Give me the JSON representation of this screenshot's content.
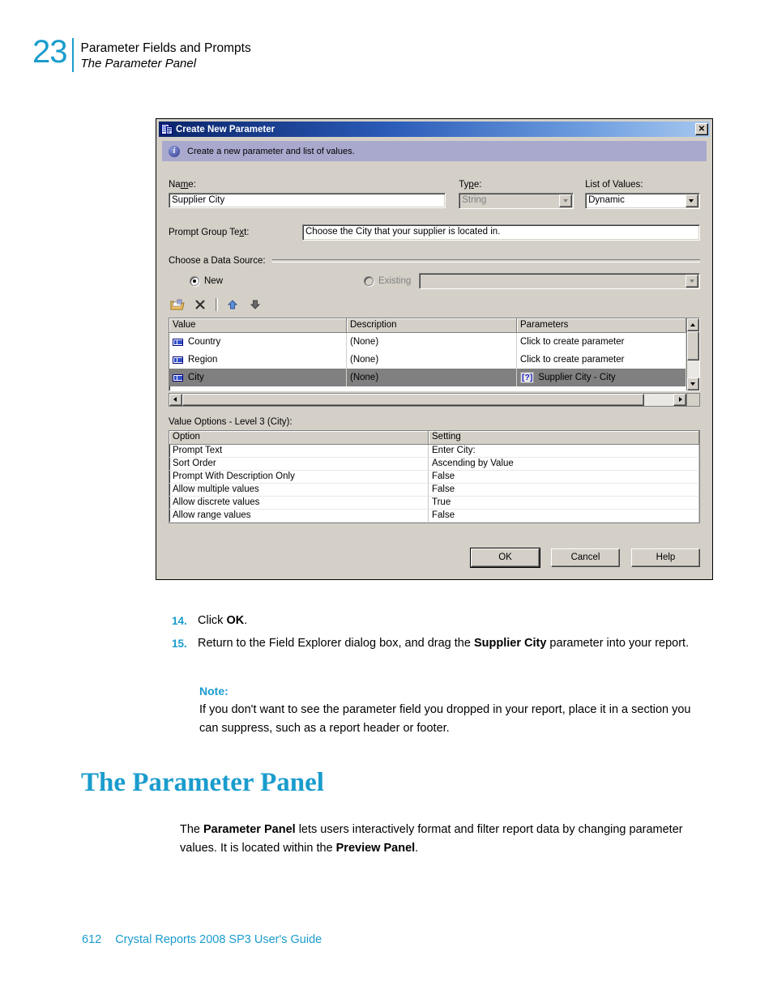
{
  "page_header": {
    "chapter_number": "23",
    "title": "Parameter Fields and Prompts",
    "subtitle": "The Parameter Panel"
  },
  "accent_color": "#1a9ccd",
  "dialog": {
    "title": "Create New Parameter",
    "titlebar_icon": "parameter-field-icon",
    "close_label": "✕",
    "banner": {
      "icon": "info-icon",
      "text": "Create a new parameter and list of values."
    },
    "fields": {
      "name_label": "Name:",
      "name_value": "Supplier City",
      "type_label": "Type:",
      "type_value": "String",
      "type_disabled": true,
      "lov_label": "List of Values:",
      "lov_value": "Dynamic",
      "prompt_group_label": "Prompt Group Text:",
      "prompt_group_value": "Choose the City that your supplier is located in."
    },
    "data_source": {
      "group_label": "Choose a Data Source:",
      "new_label": "New",
      "new_selected": true,
      "existing_label": "Existing",
      "existing_selected": false,
      "existing_disabled": true,
      "existing_value": ""
    },
    "toolbar": [
      {
        "name": "open-folder-icon",
        "tooltip": "Insert Data Source"
      },
      {
        "name": "delete-x-icon",
        "tooltip": "Delete"
      },
      {
        "name": "move-up-icon",
        "tooltip": "Move Up"
      },
      {
        "name": "move-down-icon",
        "tooltip": "Move Down"
      }
    ],
    "value_grid": {
      "columns": [
        "Value",
        "Description",
        "Parameters"
      ],
      "rows": [
        {
          "indent": 0,
          "value": "Country",
          "description": "(None)",
          "parameter": "Click to create parameter",
          "has_param_icon": false,
          "selected": false
        },
        {
          "indent": 1,
          "value": "Region",
          "description": "(None)",
          "parameter": "Click to create parameter",
          "has_param_icon": false,
          "selected": false
        },
        {
          "indent": 2,
          "value": "City",
          "description": "(None)",
          "parameter": "Supplier City - City",
          "param_icon_label": "[?]",
          "has_param_icon": true,
          "selected": true
        }
      ]
    },
    "value_options": {
      "label": "Value Options - Level 3 (City):",
      "columns": [
        "Option",
        "Setting"
      ],
      "rows": [
        {
          "option": "Prompt Text",
          "setting": "Enter City:"
        },
        {
          "option": "Sort Order",
          "setting": "Ascending by Value"
        },
        {
          "option": "Prompt With Description Only",
          "setting": "False"
        },
        {
          "option": "Allow multiple values",
          "setting": "False"
        },
        {
          "option": "Allow discrete values",
          "setting": "True"
        },
        {
          "option": "Allow range values",
          "setting": "False"
        }
      ]
    },
    "buttons": [
      {
        "label": "OK",
        "default": true
      },
      {
        "label": "Cancel",
        "default": false
      },
      {
        "label": "Help",
        "default": false
      }
    ]
  },
  "steps": [
    {
      "number": "14.",
      "segments": [
        {
          "text": "Click ",
          "bold": false
        },
        {
          "text": "OK",
          "bold": true
        },
        {
          "text": ".",
          "bold": false
        }
      ]
    },
    {
      "number": "15.",
      "segments": [
        {
          "text": "Return to the Field Explorer dialog box, and drag the ",
          "bold": false
        },
        {
          "text": "Supplier City",
          "bold": true
        },
        {
          "text": " parameter into your report.",
          "bold": false
        }
      ]
    }
  ],
  "note": {
    "title": "Note:",
    "body": "If you don't want to see the parameter field you dropped in your report, place it in a section you can suppress, such as a report header or footer."
  },
  "section": {
    "heading": "The Parameter Panel",
    "body_segments": [
      {
        "text": "The ",
        "bold": false
      },
      {
        "text": "Parameter Panel",
        "bold": true
      },
      {
        "text": " lets users interactively format and filter report data by changing parameter values. It is located within the ",
        "bold": false
      },
      {
        "text": "Preview Panel",
        "bold": true
      },
      {
        "text": ".",
        "bold": false
      }
    ]
  },
  "footer": {
    "page_number": "612",
    "book_title": "Crystal Reports 2008 SP3 User's Guide"
  }
}
